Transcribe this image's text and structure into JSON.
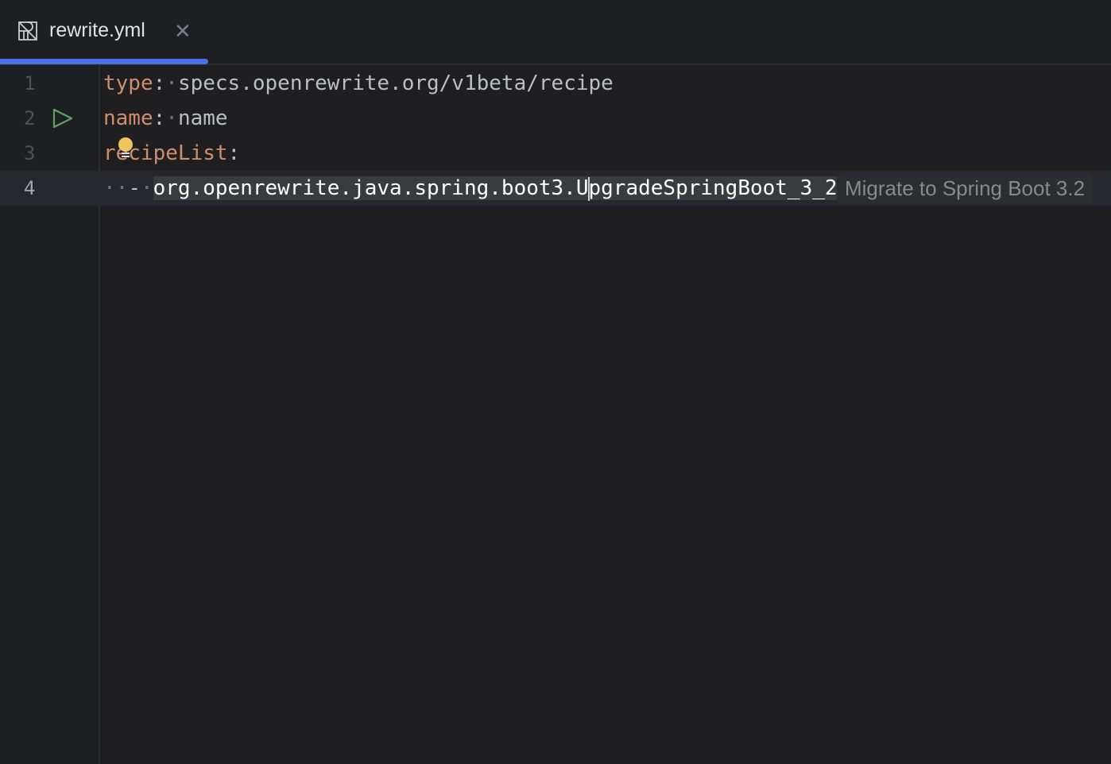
{
  "tab": {
    "filename": "rewrite.yml",
    "close": "✕"
  },
  "editor": {
    "lines": [
      {
        "number": "1",
        "key": "type",
        "sep": ":",
        "value": "specs.openrewrite.org/v1beta/recipe"
      },
      {
        "number": "2",
        "key": "name",
        "sep": ":",
        "value": "name"
      },
      {
        "number": "3",
        "key": "recipeList",
        "sep": ":"
      },
      {
        "number": "4",
        "dash": "-",
        "value_before_caret": "org.openrewrite.java.spring.boot3.U",
        "value_after_caret": "pgradeSpringBoot_3_2"
      }
    ],
    "inlay_hint": "Migrate to Spring Boot 3.2"
  },
  "colors": {
    "accent": "#4a73e8",
    "key": "#cf8e6d",
    "run": "#5fa35f",
    "bulb": "#f2c55c"
  }
}
